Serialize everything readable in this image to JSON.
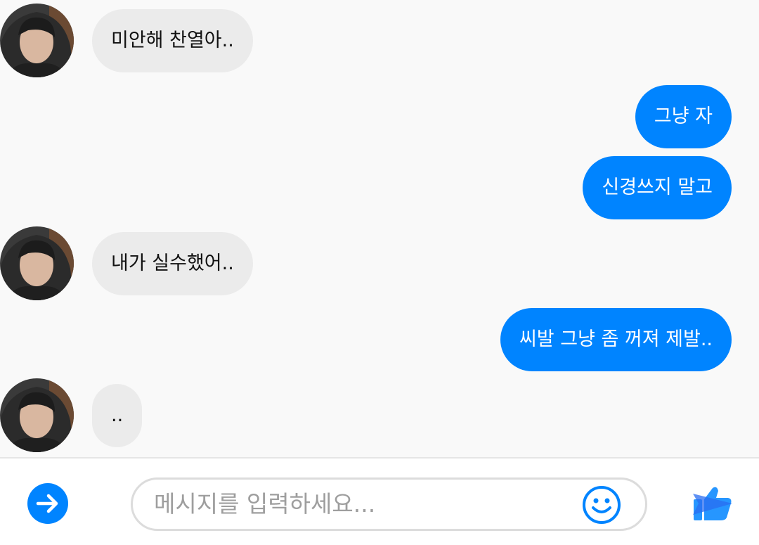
{
  "messages": [
    {
      "direction": "incoming",
      "text": "미안해 찬열아.."
    },
    {
      "direction": "outgoing",
      "text": "그냥 자"
    },
    {
      "direction": "outgoing",
      "text": "신경쓰지 말고"
    },
    {
      "direction": "incoming",
      "text": "내가 실수했어.."
    },
    {
      "direction": "outgoing",
      "text": "씨발 그냥 좀 꺼져 제발.."
    },
    {
      "direction": "incoming",
      "text": ".."
    }
  ],
  "composer": {
    "placeholder": "메시지를 입력하세요...",
    "expand_icon": "arrow-right-circle-icon",
    "emoji_icon": "smiley-icon",
    "send_icon": "thumbs-up-send-icon"
  },
  "colors": {
    "accent": "#0084ff",
    "incoming_bubble": "#ebebeb",
    "background": "#f9f9f9"
  }
}
